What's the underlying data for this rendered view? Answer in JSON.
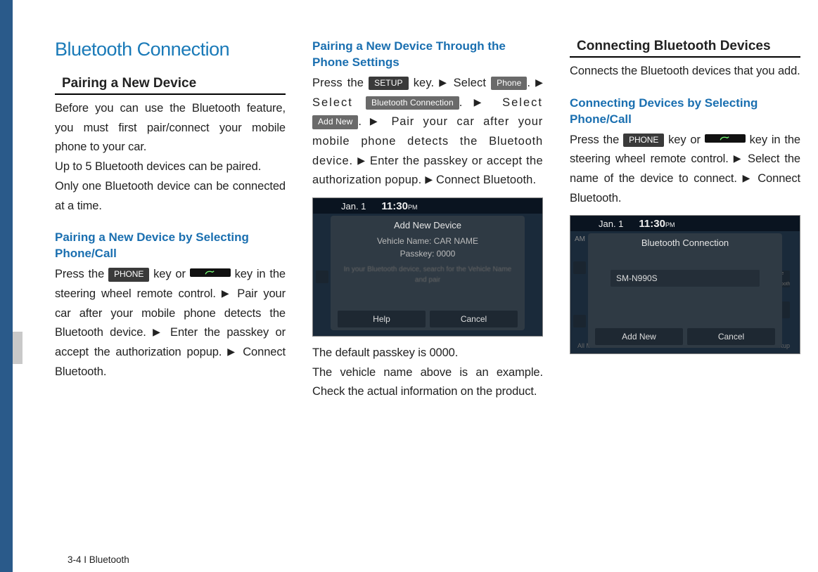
{
  "footer": "3-4 I Bluetooth",
  "main_title": "Bluetooth Connection",
  "arrow": "▶",
  "col1": {
    "section_title": "Pairing a New Device",
    "intro_1": "Before you can use the Bluetooth feature, you must first pair/connect your mobile phone to your car.",
    "intro_2": "Up to 5 Bluetooth devices can be paired.",
    "intro_3": "Only one Bluetooth device can be connected at a time.",
    "sub1_title": "Pairing a New Device by Selecting Phone/Call",
    "sub1_p_a": "Press the ",
    "sub1_key_phone": "PHONE",
    "sub1_p_b": " key or ",
    "sub1_p_c": " key in the steering wheel remote  control. ",
    "sub1_p_d": " Pair your car after your mobile phone detects the Bluetooth device. ",
    "sub1_p_e": " Enter the passkey or accept the authorization popup. ",
    "sub1_p_f": " Connect Bluetooth."
  },
  "col2": {
    "sub1_title": "Pairing a New Device Through the Phone Settings",
    "p_a": "Press the ",
    "key_setup": "SETUP",
    "p_b": " key. ",
    "p_c": " Select ",
    "key_phone": "Phone",
    "p_d": ". ",
    "p_e": " Select ",
    "key_btc": "Bluetooth Connection",
    "p_f": ". ",
    "p_g": " Select ",
    "key_addnew": "Add New",
    "p_h": ". ",
    "p_i": " Pair your car after your mobile phone detects the Bluetooth device. ",
    "p_j": " Enter the passkey or accept the authorization popup. ",
    "p_k": " Connect Bluetooth.",
    "screenshot": {
      "date": "Jan.  1",
      "time": "11:30",
      "pm": "PM",
      "popup_title": "Add New Device",
      "line1": "Vehicle Name: CAR NAME",
      "line2": "Passkey:  0000",
      "line3": "In your Bluetooth device, search for the Vehicle Name and pair",
      "btn_help": "Help",
      "btn_cancel": "Cancel"
    },
    "after_1": "The default passkey is 0000.",
    "after_2": "The vehicle name above is an example. Check the actual information on the product."
  },
  "col3": {
    "section_title": "Connecting Bluetooth Devices",
    "intro": "Connects the Bluetooth devices that you add.",
    "sub1_title": "Connecting Devices by Selecting Phone/Call",
    "p_a": "Press the ",
    "key_phone": "PHONE",
    "p_b": " key or ",
    "p_c": " key in the steering wheel remote  control. ",
    "p_d": " Select the name of the device to connect. ",
    "p_e": " Connect Bluetooth.",
    "screenshot": {
      "date": "Jan.  1",
      "time": "11:30",
      "pm": "PM",
      "am": "AM",
      "popup_title": "Bluetooth Connection",
      "device": "SM-N990S",
      "side1": "device using Bluetooth",
      "btn_add": "Add New",
      "btn_cancel": "Cancel",
      "bottom1": "All Menus",
      "bottom2": "Setup"
    }
  }
}
